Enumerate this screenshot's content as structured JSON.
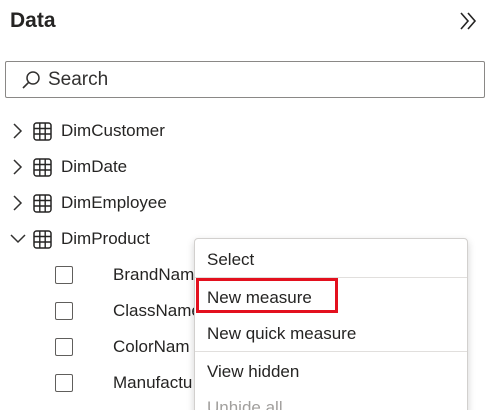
{
  "pane": {
    "title": "Data",
    "collapse_icon": "double-chevron-right-icon"
  },
  "search": {
    "placeholder": "Search",
    "icon": "search-icon"
  },
  "tables": [
    {
      "name": "DimCustomer",
      "expanded": false
    },
    {
      "name": "DimDate",
      "expanded": false
    },
    {
      "name": "DimEmployee",
      "expanded": false
    },
    {
      "name": "DimProduct",
      "expanded": true
    }
  ],
  "fields": [
    {
      "name": "BrandNam",
      "checked": false
    },
    {
      "name": "ClassName",
      "checked": false
    },
    {
      "name": "ColorNam",
      "checked": false
    },
    {
      "name": "Manufactu",
      "checked": false
    }
  ],
  "context_menu": {
    "items": [
      {
        "label": "Select",
        "disabled": false
      },
      {
        "label": "New measure",
        "disabled": false,
        "highlighted": true
      },
      {
        "label": "New quick measure",
        "disabled": false
      },
      {
        "label": "View hidden",
        "disabled": false
      },
      {
        "label": "Unhide all",
        "disabled": true
      }
    ]
  },
  "colors": {
    "highlight": "#e3101e",
    "text": "#252423",
    "disabled_text": "#a19f9d"
  }
}
